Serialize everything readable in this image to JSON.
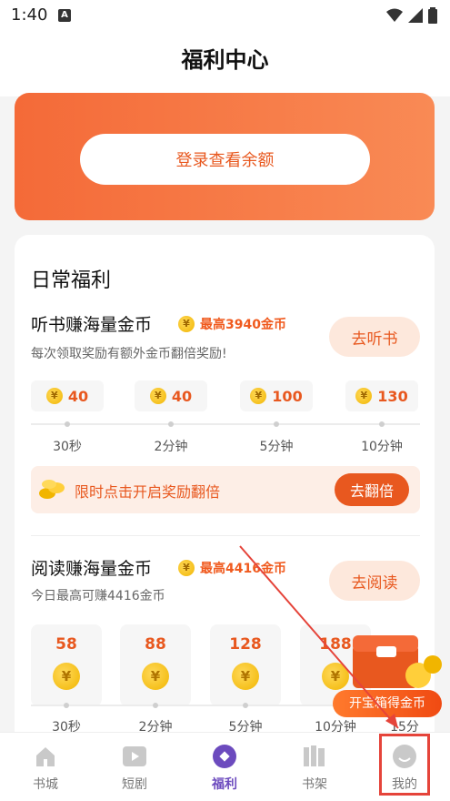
{
  "status_bar": {
    "time": "1:40",
    "app_icon_letter": "A"
  },
  "header": {
    "title": "福利中心"
  },
  "hero": {
    "login_button": "登录查看余额"
  },
  "daily": {
    "section_title": "日常福利",
    "listen": {
      "title": "听书赚海量金币",
      "max_text": "最高3940金币",
      "subtitle": "每次领取奖励有额外金币翻倍奖励!",
      "action": "去听书",
      "rewards": [
        {
          "amount": "40",
          "time": "30秒"
        },
        {
          "amount": "40",
          "time": "2分钟"
        },
        {
          "amount": "100",
          "time": "5分钟"
        },
        {
          "amount": "130",
          "time": "10分钟"
        }
      ],
      "banner_text": "限时点击开启奖励翻倍",
      "banner_button": "去翻倍"
    },
    "read": {
      "title": "阅读赚海量金币",
      "max_text": "最高4416金币",
      "subtitle": "今日最高可赚4416金币",
      "action": "去阅读",
      "rewards": [
        {
          "amount": "58",
          "time": "30秒"
        },
        {
          "amount": "88",
          "time": "2分钟"
        },
        {
          "amount": "128",
          "time": "5分钟"
        },
        {
          "amount": "188",
          "time": "10分钟"
        },
        {
          "amount": "",
          "time": "15分"
        }
      ]
    }
  },
  "floating": {
    "label": "开宝箱得金币"
  },
  "bottom_nav": [
    {
      "label": "书城",
      "icon": "bookstore-icon"
    },
    {
      "label": "短剧",
      "icon": "play-icon"
    },
    {
      "label": "福利",
      "icon": "welfare-icon"
    },
    {
      "label": "书架",
      "icon": "bookshelf-icon"
    },
    {
      "label": "我的",
      "icon": "profile-icon"
    }
  ],
  "colors": {
    "accent": "#e8581f",
    "nav_active": "#6c4bbe",
    "highlight": "#e5443a"
  }
}
